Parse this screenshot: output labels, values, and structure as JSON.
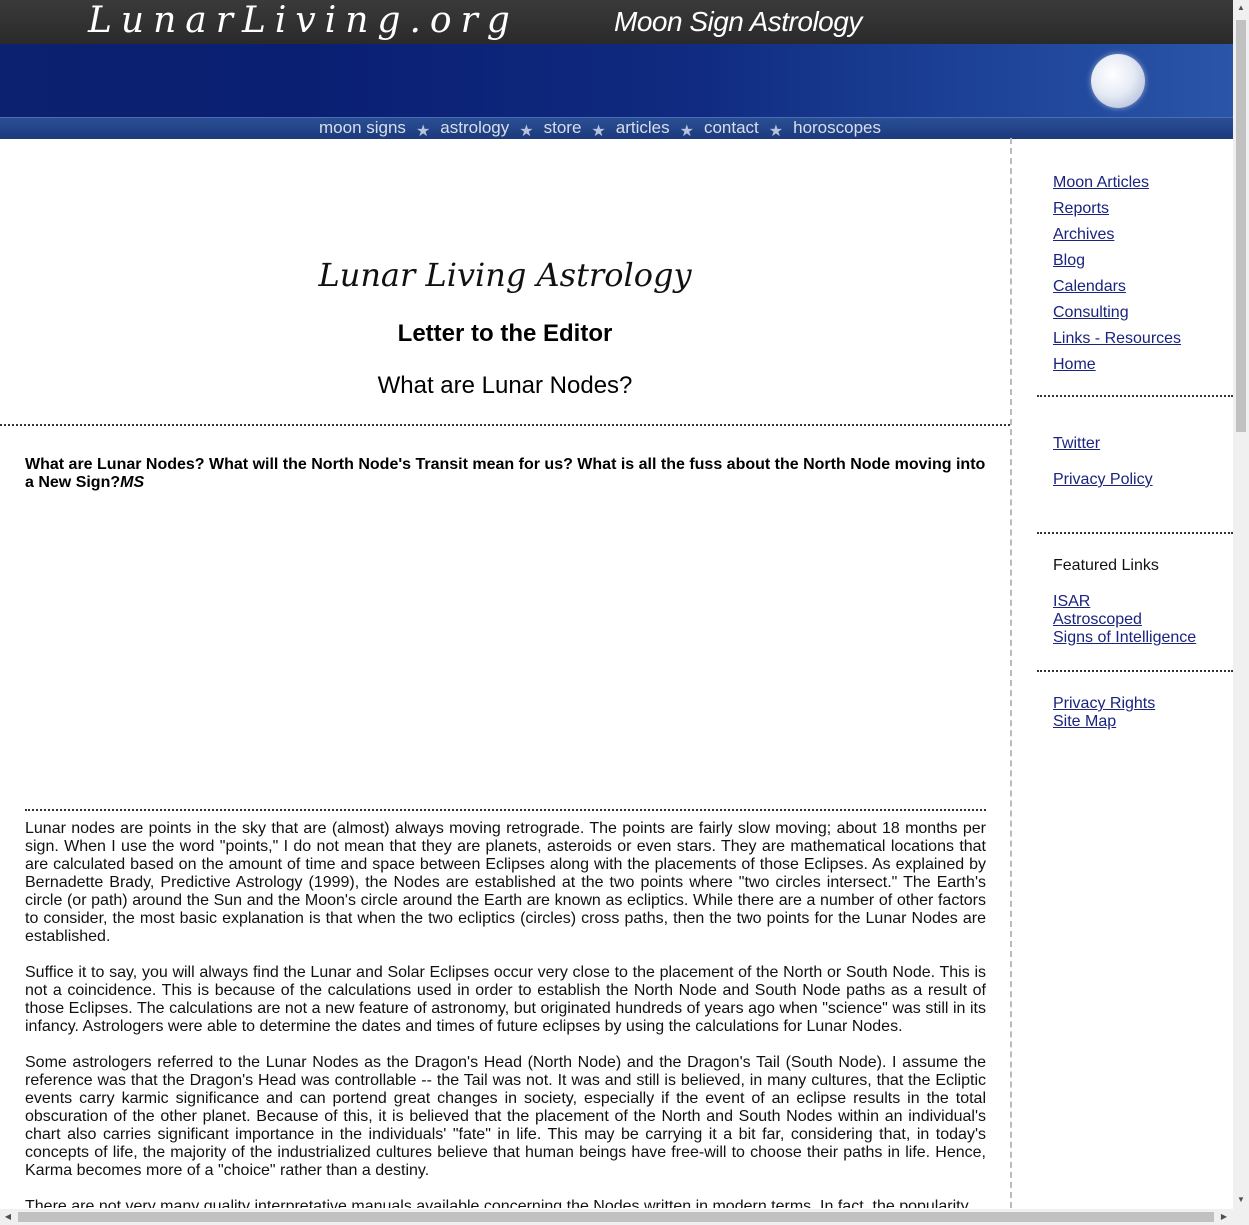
{
  "header": {
    "logo": "LunarLiving.org",
    "tagline": "Moon Sign Astrology"
  },
  "nav": [
    {
      "label": "moon signs"
    },
    {
      "label": "astrology"
    },
    {
      "label": "store"
    },
    {
      "label": "articles"
    },
    {
      "label": "contact"
    },
    {
      "label": "horoscopes"
    }
  ],
  "nav_separator": "★",
  "page": {
    "title": "Lunar Living Astrology",
    "subtitle": "Letter to the Editor",
    "question_title": "What are Lunar Nodes?",
    "intro_question": "What are Lunar Nodes? What will the North Node's Transit mean for us? What is all the fuss about the North Node moving into a New Sign?",
    "intro_signature": "MS"
  },
  "article": [
    "Lunar nodes are points in the sky that are (almost) always moving retrograde. The points are fairly slow moving; about 18 months per sign. When I use the word \"points,\" I do not mean that they are planets, asteroids or even stars. They are mathematical locations that are calculated based on the amount of time and space between Eclipses along with the placements of those Eclipses. As explained by Bernadette Brady, Predictive Astrology (1999), the Nodes are established at the two points where \"two circles intersect.\" The Earth's circle (or path) around the Sun and the Moon's circle around the Earth are known as ecliptics. While there are a number of other factors to consider, the most basic explanation is that when the two ecliptics (circles) cross paths, then the two points for the Lunar Nodes are established.",
    "Suffice it to say, you will always find the Lunar and Solar Eclipses occur very close to the placement of the North or South Node. This is not a coincidence. This is because of the calculations used in order to establish the North Node and South Node paths as a result of those Eclipses. The calculations are not a new feature of astronomy, but originated hundreds of years ago when \"science\" was still in its infancy. Astrologers were able to determine the dates and times of future eclipses by using the calculations for Lunar Nodes.",
    "Some astrologers referred to the Lunar Nodes as the Dragon's Head (North Node) and the Dragon's Tail (South Node). I assume the reference was that the Dragon's Head was controllable -- the Tail was not. It was and still is believed, in many cultures, that the Ecliptic events carry karmic significance and can portend great changes in society, especially if the event of an eclipse results in the total obscuration of the other planet. Because of this, it is believed that the placement of the North and South Nodes within an individual's chart also carries significant importance in the individuals' \"fate\" in life. This may be carrying it a bit far, considering that, in today's concepts of life, the majority of the industrialized cultures believe that human beings have free-will to choose their paths in life. Hence, Karma becomes more of a \"choice\" rather than a destiny.",
    "There are not very many quality interpretative manuals available concerning the Nodes written in modern terms. In fact, the popularity"
  ],
  "sidebar": {
    "main_links": [
      "Moon Articles",
      "Reports",
      "Archives",
      "Blog",
      "Calendars",
      "Consulting",
      "Links - Resources",
      "Home"
    ],
    "social_links": [
      "Twitter",
      "Privacy Policy"
    ],
    "featured_heading": "Featured Links",
    "featured_links": [
      "ISAR",
      "Astroscoped",
      "Signs of Intelligence"
    ],
    "legal_links": [
      "Privacy Rights",
      "Site Map"
    ]
  }
}
